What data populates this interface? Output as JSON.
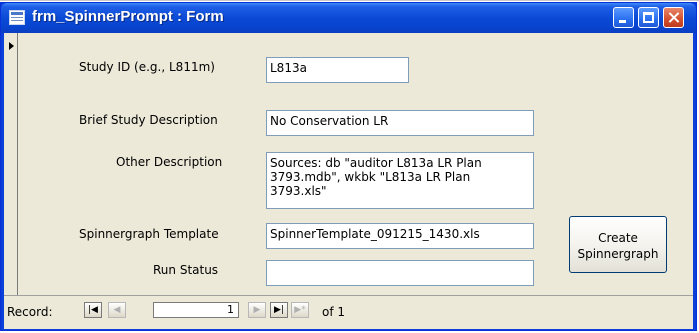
{
  "window": {
    "title": "frm_SpinnerPrompt : Form"
  },
  "form": {
    "study_id": {
      "label": "Study ID (e.g., L811m)",
      "value": "L813a"
    },
    "brief_description": {
      "label": "Brief Study Description",
      "value": "No Conservation LR"
    },
    "other_description": {
      "label": "Other Description",
      "value_lines": [
        "Sources: db \"auditor L813a LR Plan",
        "3793.mdb\", wkbk \"L813a LR Plan",
        "3793.xls\""
      ]
    },
    "template": {
      "label": "Spinnergraph Template",
      "value": "SpinnerTemplate_091215_1430.xls"
    },
    "run_status": {
      "label": "Run Status",
      "value": ""
    },
    "create_button": {
      "line1": "Create",
      "line2": "Spinnergraph"
    }
  },
  "navigation": {
    "label": "Record:",
    "current": "1",
    "of_text": "of",
    "total": "1",
    "first_glyph": "|◀",
    "prev_glyph": "◀",
    "next_glyph": "▶",
    "last_glyph": "▶|",
    "new_glyph": "▶*"
  },
  "colors": {
    "titlebar": "#0a4ad6",
    "client": "#ece9d8",
    "field_border": "#7f9db9"
  }
}
